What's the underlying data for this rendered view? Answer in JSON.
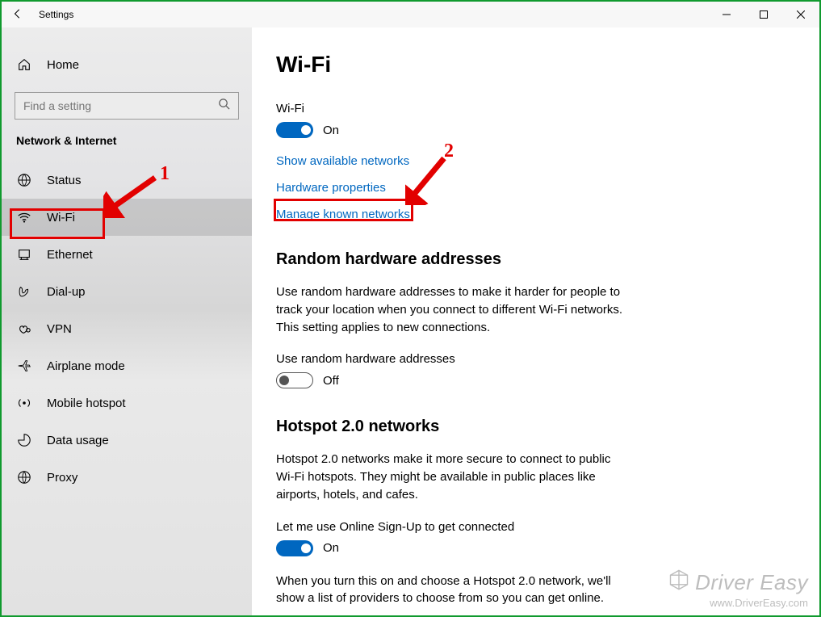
{
  "window": {
    "title": "Settings"
  },
  "sidebar": {
    "home": "Home",
    "search_placeholder": "Find a setting",
    "category": "Network & Internet",
    "items": [
      {
        "label": "Status",
        "icon": "status"
      },
      {
        "label": "Wi-Fi",
        "icon": "wifi"
      },
      {
        "label": "Ethernet",
        "icon": "ethernet"
      },
      {
        "label": "Dial-up",
        "icon": "dialup"
      },
      {
        "label": "VPN",
        "icon": "vpn"
      },
      {
        "label": "Airplane mode",
        "icon": "airplane"
      },
      {
        "label": "Mobile hotspot",
        "icon": "hotspot"
      },
      {
        "label": "Data usage",
        "icon": "datausage"
      },
      {
        "label": "Proxy",
        "icon": "proxy"
      }
    ],
    "selected_index": 1
  },
  "content": {
    "page_title": "Wi-Fi",
    "wifi_toggle": {
      "label": "Wi-Fi",
      "state_text": "On",
      "on": true
    },
    "links": {
      "show_available": "Show available networks",
      "hardware_props": "Hardware properties",
      "manage_known": "Manage known networks"
    },
    "random_hw": {
      "heading": "Random hardware addresses",
      "description": "Use random hardware addresses to make it harder for people to track your location when you connect to different Wi-Fi networks. This setting applies to new connections.",
      "toggle_label": "Use random hardware addresses",
      "state_text": "Off",
      "on": false
    },
    "hotspot2": {
      "heading": "Hotspot 2.0 networks",
      "description": "Hotspot 2.0 networks make it more secure to connect to public Wi-Fi hotspots. They might be available in public places like airports, hotels, and cafes.",
      "toggle_label": "Let me use Online Sign-Up to get connected",
      "state_text": "On",
      "on": true,
      "footer": "When you turn this on and choose a Hotspot 2.0 network, we'll show a list of providers to choose from so you can get online."
    }
  },
  "annotations": {
    "num1": "1",
    "num2": "2"
  },
  "watermark": {
    "brand": "Driver Easy",
    "url": "www.DriverEasy.com"
  }
}
